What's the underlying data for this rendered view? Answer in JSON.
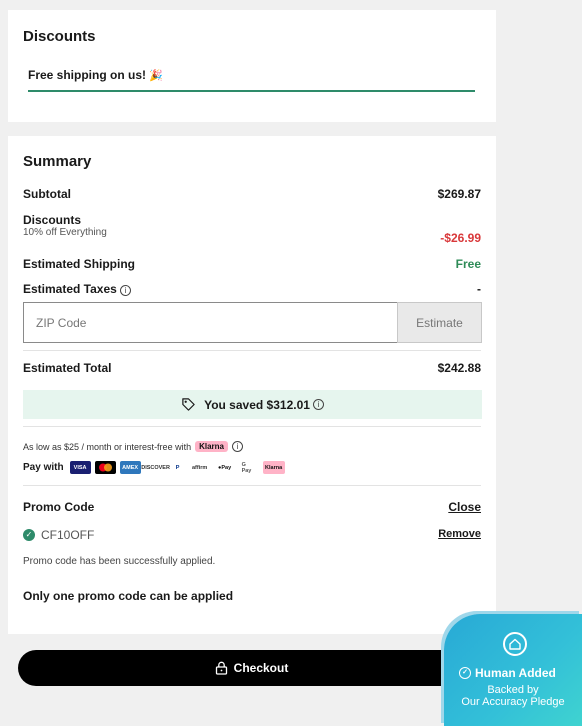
{
  "discounts": {
    "title": "Discounts",
    "applied_text": "Free shipping on us!",
    "emoji": "🎉"
  },
  "summary": {
    "title": "Summary",
    "subtotal_label": "Subtotal",
    "subtotal_value": "$269.87",
    "discounts_label": "Discounts",
    "discounts_sub": "10% off Everything",
    "discounts_value": "-$26.99",
    "shipping_label": "Estimated Shipping",
    "shipping_value": "Free",
    "taxes_label": "Estimated Taxes",
    "taxes_value": "-",
    "zip_placeholder": "ZIP Code",
    "estimate_label": "Estimate",
    "total_label": "Estimated Total",
    "total_value": "$242.88",
    "saved_text": "You saved $312.01",
    "as_low_as": "As low as $25 / month or interest-free with",
    "klarna": "Klarna",
    "pay_with": "Pay with",
    "payment_methods": [
      "VISA",
      "",
      "AMEX",
      "DISCOVER",
      "P",
      "affirm",
      "Pay",
      "G Pay",
      "Klarna"
    ]
  },
  "promo": {
    "label": "Promo Code",
    "close": "Close",
    "code": "CF10OFF",
    "remove": "Remove",
    "message": "Promo code has been successfully applied.",
    "only_one": "Only one promo code can be applied"
  },
  "checkout": {
    "label": "Checkout"
  },
  "badge": {
    "title": "Human Added",
    "line1": "Backed by",
    "line2": "Our Accuracy Pledge"
  },
  "colors": {
    "accent_green": "#2e8b6a",
    "discount_red": "#d9383a",
    "saved_bg": "#e6f5ee",
    "badge_blue": "#33c0d8"
  }
}
